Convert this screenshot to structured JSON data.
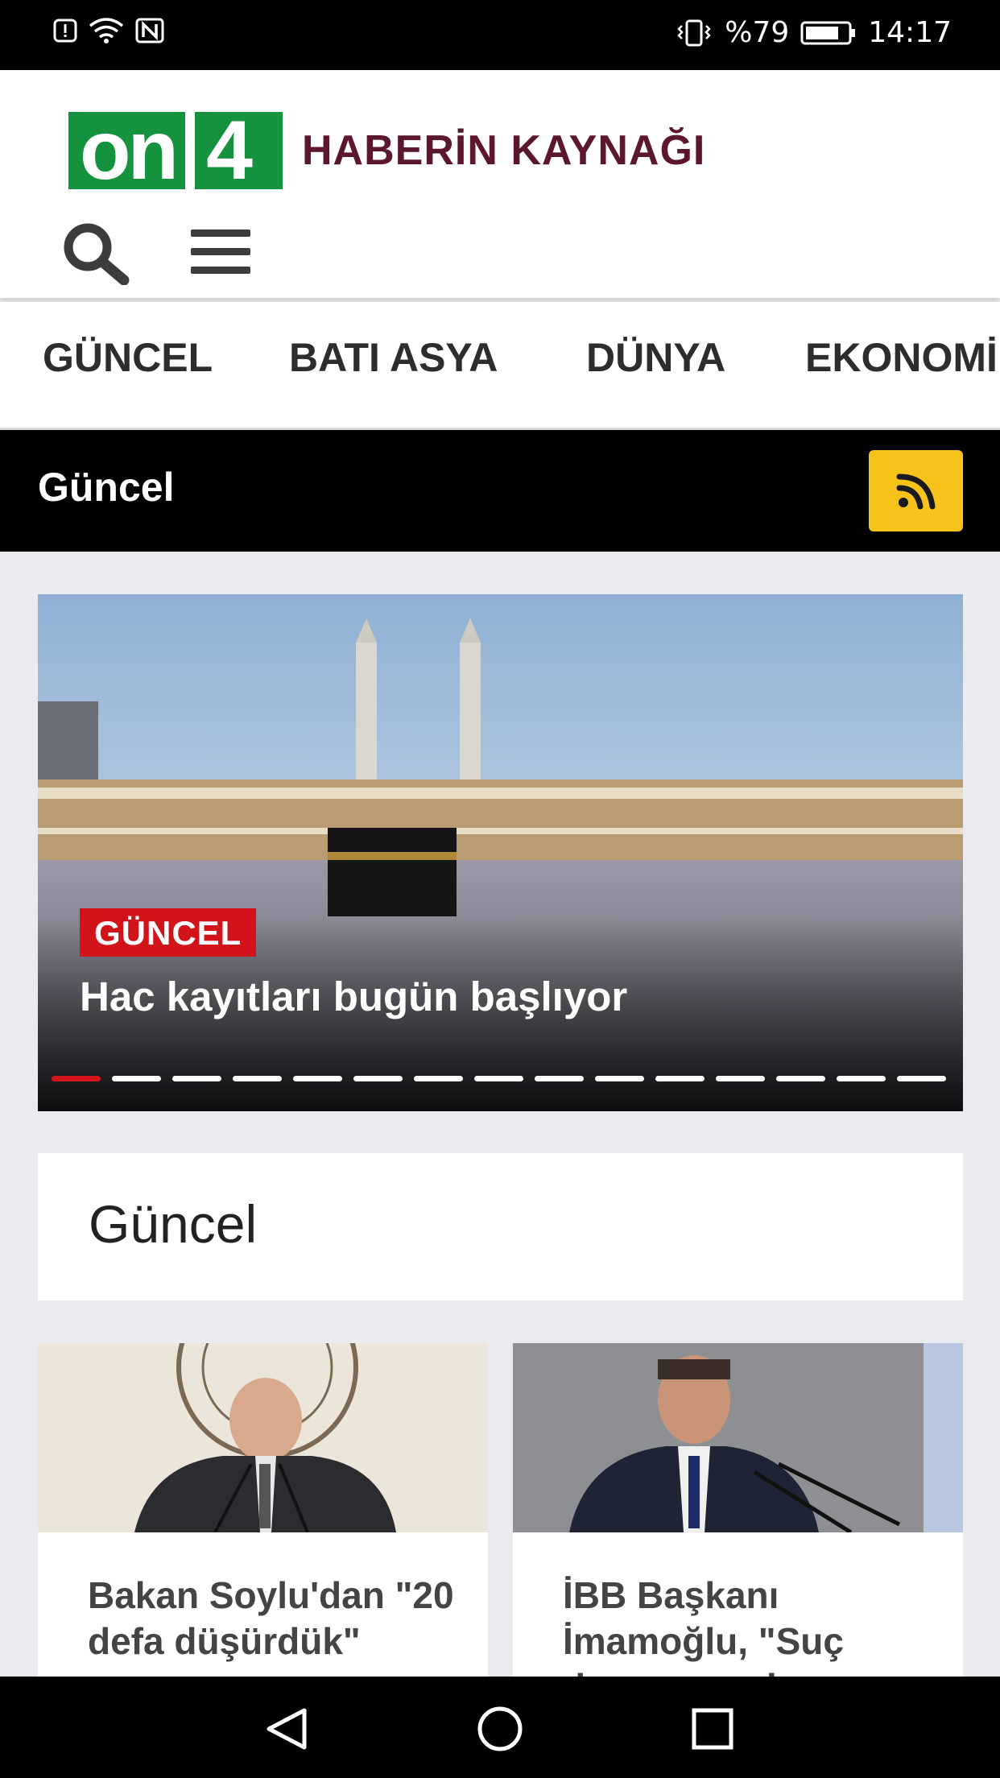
{
  "status_bar": {
    "battery": "%79",
    "time": "14:17",
    "left_icons": [
      "alert-icon",
      "wifi-icon",
      "nfc-icon"
    ],
    "right_icons": [
      "vibrate-icon",
      "battery-icon"
    ]
  },
  "header": {
    "logo_on": "on",
    "logo_4": "4",
    "tagline": "HABERİN KAYNAĞI",
    "brand_color": "#14923e",
    "tagline_color": "#5b1630"
  },
  "categories": [
    "GÜNCEL",
    "BATI ASYA",
    "DÜNYA",
    "EKONOMİ"
  ],
  "section": {
    "title": "Güncel",
    "rss_color": "#f7c31a"
  },
  "hero": {
    "badge": "GÜNCEL",
    "title": "Hac kayıtları bugün başlıyor",
    "slide_count": 15,
    "active_slide": 1,
    "badge_color": "#d0141a"
  },
  "list": {
    "title": "Güncel"
  },
  "cards": [
    {
      "title": "Bakan Soylu'dan \"20 defa düşürdük\""
    },
    {
      "title": "İBB Başkanı İmamoğlu, \"Suç duyurusunda"
    }
  ],
  "nav_bar": {
    "icons": [
      "back-icon",
      "home-icon",
      "recents-icon"
    ]
  }
}
